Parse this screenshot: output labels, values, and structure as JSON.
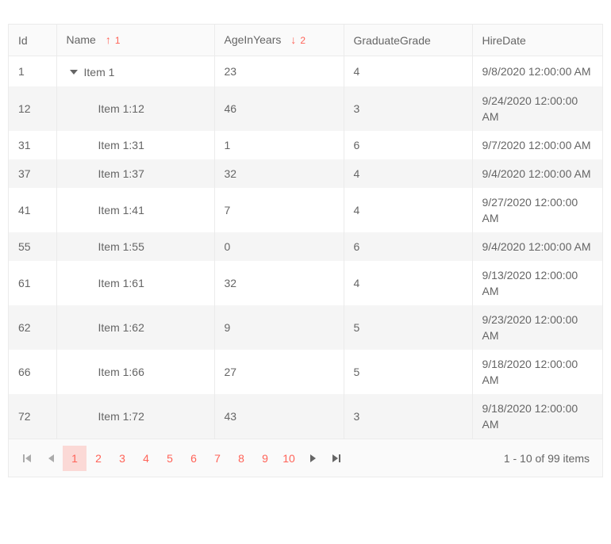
{
  "colors": {
    "accent": "#ff6358",
    "selected_page_bg": "#fbd9d6",
    "header_bg": "#fafafa",
    "alt_row_bg": "#f5f5f5",
    "border": "#ebebeb",
    "text": "#656565"
  },
  "icons": {
    "sort_asc": "↑",
    "sort_desc": "↓"
  },
  "table": {
    "columns": [
      {
        "label": "Id"
      },
      {
        "label": "Name",
        "sort_dir": "asc",
        "sort_order": "1"
      },
      {
        "label": "AgeInYears",
        "sort_dir": "desc",
        "sort_order": "2"
      },
      {
        "label": "GraduateGrade"
      },
      {
        "label": "HireDate"
      }
    ],
    "rows": [
      {
        "id": "1",
        "name": "Item 1",
        "expandable": true,
        "age": "23",
        "grade": "4",
        "hire": "9/8/2020 12:00:00 AM"
      },
      {
        "id": "12",
        "name": "Item 1:12",
        "expandable": false,
        "age": "46",
        "grade": "3",
        "hire": "9/24/2020 12:00:00 AM"
      },
      {
        "id": "31",
        "name": "Item 1:31",
        "expandable": false,
        "age": "1",
        "grade": "6",
        "hire": "9/7/2020 12:00:00 AM"
      },
      {
        "id": "37",
        "name": "Item 1:37",
        "expandable": false,
        "age": "32",
        "grade": "4",
        "hire": "9/4/2020 12:00:00 AM"
      },
      {
        "id": "41",
        "name": "Item 1:41",
        "expandable": false,
        "age": "7",
        "grade": "4",
        "hire": "9/27/2020 12:00:00 AM"
      },
      {
        "id": "55",
        "name": "Item 1:55",
        "expandable": false,
        "age": "0",
        "grade": "6",
        "hire": "9/4/2020 12:00:00 AM"
      },
      {
        "id": "61",
        "name": "Item 1:61",
        "expandable": false,
        "age": "32",
        "grade": "4",
        "hire": "9/13/2020 12:00:00 AM"
      },
      {
        "id": "62",
        "name": "Item 1:62",
        "expandable": false,
        "age": "9",
        "grade": "5",
        "hire": "9/23/2020 12:00:00 AM"
      },
      {
        "id": "66",
        "name": "Item 1:66",
        "expandable": false,
        "age": "27",
        "grade": "5",
        "hire": "9/18/2020 12:00:00 AM"
      },
      {
        "id": "72",
        "name": "Item 1:72",
        "expandable": false,
        "age": "43",
        "grade": "3",
        "hire": "9/18/2020 12:00:00 AM"
      }
    ]
  },
  "pager": {
    "pages": [
      "1",
      "2",
      "3",
      "4",
      "5",
      "6",
      "7",
      "8",
      "9",
      "10"
    ],
    "current": "1",
    "info": "1 - 10 of 99 items"
  }
}
